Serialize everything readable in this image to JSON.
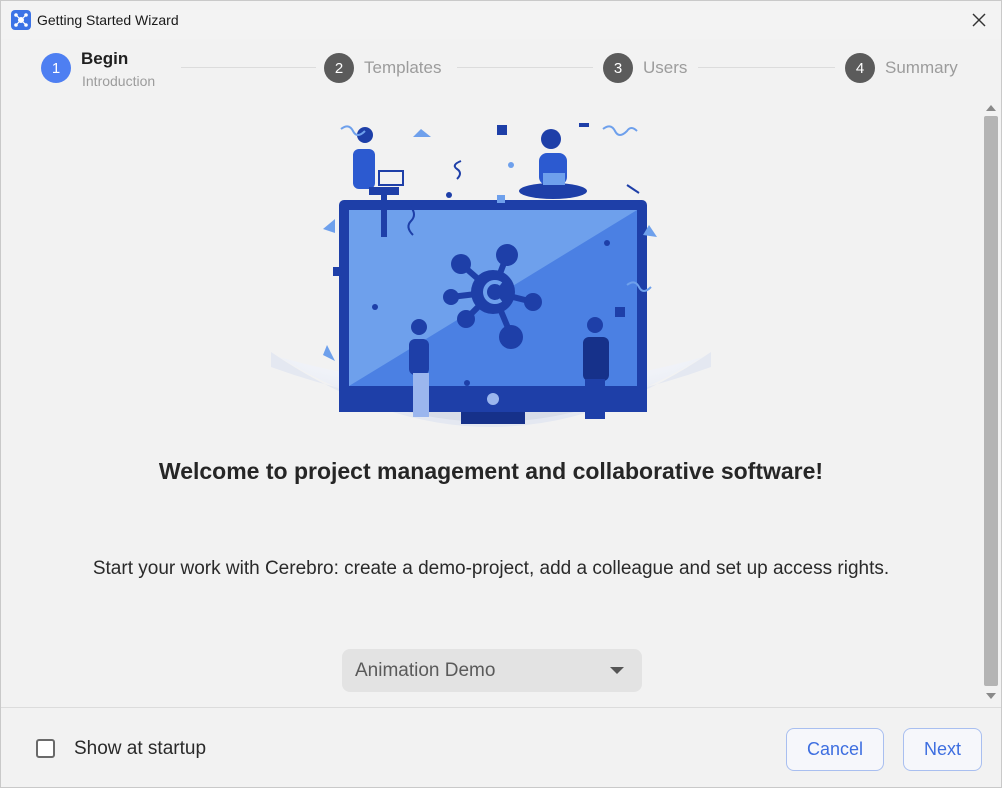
{
  "window": {
    "title": "Getting Started Wizard"
  },
  "stepper": {
    "steps": [
      {
        "number": "1",
        "label": "Begin",
        "sublabel": "Introduction",
        "active": true
      },
      {
        "number": "2",
        "label": "Templates"
      },
      {
        "number": "3",
        "label": "Users"
      },
      {
        "number": "4",
        "label": "Summary"
      }
    ]
  },
  "content": {
    "headline": "Welcome to project management and collaborative software!",
    "description": "Start your work with Cerebro: create a demo-project, add a colleague and set up access rights.",
    "project_select": {
      "value": "Animation Demo"
    }
  },
  "footer": {
    "show_at_startup_label": "Show at startup",
    "show_at_startup_checked": false,
    "cancel_label": "Cancel",
    "next_label": "Next"
  },
  "colors": {
    "accent": "#4e7ff2",
    "button_text": "#3d6ee0",
    "illustration_dark": "#1e3fa8",
    "illustration_light": "#6ea0ec"
  },
  "icons": [
    "cerebro-app-icon",
    "close-icon",
    "chevron-down-icon",
    "scroll-up-icon",
    "scroll-down-icon"
  ]
}
